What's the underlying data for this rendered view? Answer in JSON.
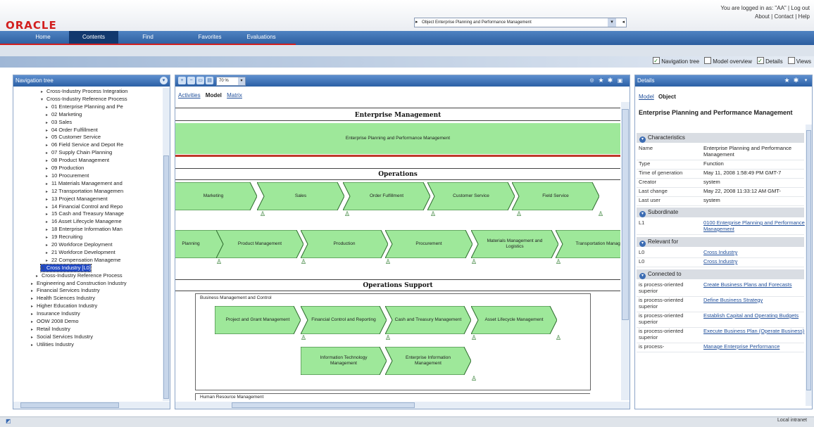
{
  "header": {
    "logo": "ORACLE",
    "logged_in": "You are logged in as: \"AA\"",
    "logout": "Log out",
    "about": "About",
    "contact": "Contact",
    "help": "Help",
    "model_select": "Object Enterprise Planning and Performance Management"
  },
  "tabs": [
    {
      "label": "Home"
    },
    {
      "label": "Contents"
    },
    {
      "label": "Find"
    },
    {
      "label": "Favorites"
    },
    {
      "label": "Evaluations"
    }
  ],
  "view_options": {
    "navigation_tree": "Navigation tree",
    "model_overview": "Model overview",
    "details": "Details",
    "views": "Views"
  },
  "nav": {
    "title": "Navigation tree",
    "items": [
      {
        "label": "Cross-Industry Process Integration"
      },
      {
        "label": "Cross-Industry Reference Process"
      },
      {
        "label": "01 Enterprise Planning and Pe"
      },
      {
        "label": "02 Marketing"
      },
      {
        "label": "03 Sales"
      },
      {
        "label": "04 Order Fulfillment"
      },
      {
        "label": "05 Customer Service"
      },
      {
        "label": "06 Field Service and Depot Re"
      },
      {
        "label": "07 Supply Chain Planning"
      },
      {
        "label": "08 Product Management"
      },
      {
        "label": "09 Production"
      },
      {
        "label": "10 Procurement"
      },
      {
        "label": "11 Materials Management and"
      },
      {
        "label": "12 Transportation Managemen"
      },
      {
        "label": "13 Project Management"
      },
      {
        "label": "14 Financial Control and Repo"
      },
      {
        "label": "15 Cash and Treasury Manage"
      },
      {
        "label": "16 Asset Lifecycle Manageme"
      },
      {
        "label": "18 Enterprise Information Man"
      },
      {
        "label": "19 Recruiting"
      },
      {
        "label": "20 Workforce Deployment"
      },
      {
        "label": "21 Workforce Development"
      },
      {
        "label": "22 Compensation Manageme"
      },
      {
        "label": "Cross Industry [L0]"
      },
      {
        "label": "Cross-Industry Reference Process"
      },
      {
        "label": "Engineering and Construction Industry"
      },
      {
        "label": "Financial Services Industry"
      },
      {
        "label": "Health Sciences Industry"
      },
      {
        "label": "Higher Education Industry"
      },
      {
        "label": "Insurance Industry"
      },
      {
        "label": "OOW 2008 Demo"
      },
      {
        "label": "Retail Industry"
      },
      {
        "label": "Social Services Industry"
      },
      {
        "label": "Utilities Industry"
      }
    ]
  },
  "center": {
    "zoom": "70 %",
    "tabs": {
      "activities": "Activities",
      "model": "Model",
      "matrix": "Matrix"
    },
    "lanes": {
      "enterprise": "Enterprise Management",
      "enterprise_box": "Enterprise Planning and Performance Management",
      "operations": "Operations",
      "support": "Operations Support",
      "support_group": "Business Management and Control",
      "bottom_group": "Human Resource Management"
    },
    "ops_row1": [
      "Marketing",
      "Sales",
      "Order Fulfillment",
      "Customer Service",
      "Field Service"
    ],
    "ops_row2": [
      "Planning",
      "Product Management",
      "Production",
      "Procurement",
      "Materials Management and Logistics",
      "Transportation Manage"
    ],
    "support_row1": [
      "Project and Grant Management",
      "Financial Control and Reporting",
      "Cash and Treasury Management",
      "Asset Lifecycle Management"
    ],
    "support_row2": [
      "Information Technology Management",
      "Enterprise Information Management"
    ]
  },
  "details": {
    "title": "Details",
    "tab_model": "Model",
    "tab_object": "Object",
    "object_name": "Enterprise Planning and Performance Management",
    "sections": {
      "characteristics": "Characteristics",
      "subordinate": "Subordinate",
      "relevant_for": "Relevant for",
      "connected_to": "Connected to"
    },
    "characteristics": [
      {
        "k": "Name",
        "v": "Enterprise Planning and Performance Management"
      },
      {
        "k": "Type",
        "v": "Function"
      },
      {
        "k": "Time of generation",
        "v": "May 11, 2008 1:58:49 PM GMT-7"
      },
      {
        "k": "Creator",
        "v": "system"
      },
      {
        "k": "Last change",
        "v": "May 22, 2008 11:33:12 AM GMT-"
      },
      {
        "k": "Last user",
        "v": "system"
      }
    ],
    "subordinate": [
      {
        "k": "L1",
        "v": "0100 Enterprise Planning and Performance Management"
      }
    ],
    "relevant": [
      {
        "k": "L0",
        "v": "Cross Industry"
      },
      {
        "k": "L0",
        "v": "Cross Industry"
      }
    ],
    "connected": [
      {
        "k": "is process-oriented superior",
        "v": "Create Business Plans and Forecasts"
      },
      {
        "k": "is process-oriented superior",
        "v": "Define Business Strategy"
      },
      {
        "k": "is process-oriented superior",
        "v": "Establish Capital and Operating Budgets"
      },
      {
        "k": "is process-oriented superior",
        "v": "Execute Business Plan (Operate Business)"
      },
      {
        "k": "is process-",
        "v": "Manage Enterprise Performance"
      }
    ]
  },
  "status": {
    "zone": "Local intranet"
  }
}
